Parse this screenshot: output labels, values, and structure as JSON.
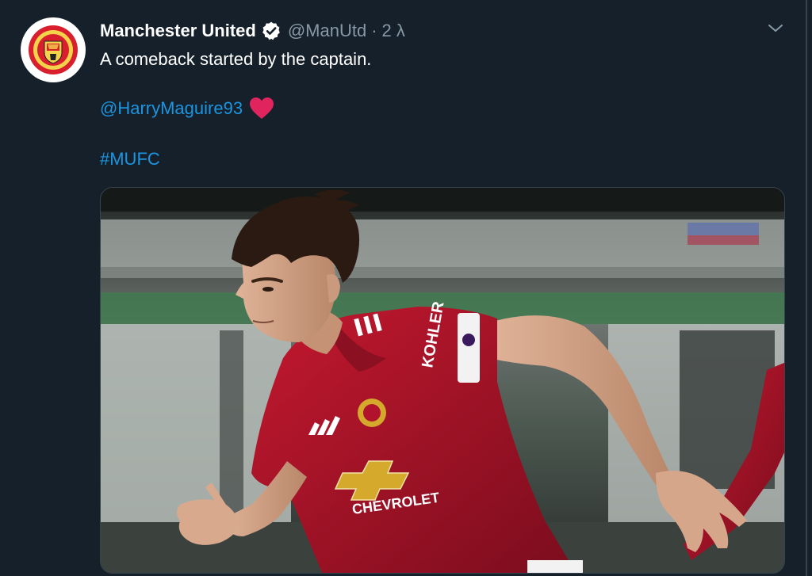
{
  "tweet": {
    "display_name": "Manchester United",
    "handle": "@ManUtd",
    "separator": "·",
    "time": "2 λ",
    "text_line1": "A comeback started by the captain.",
    "mention": "@HarryMaguire93",
    "hashtag": "#MUFC"
  },
  "icons": {
    "avatar": "manchester-united-crest-icon",
    "verified": "verified-badge-icon",
    "caret": "chevron-down-icon",
    "heart": "red-heart-emoji-icon"
  },
  "media": {
    "shirt_sponsor": "CHEVROLET",
    "sleeve_sponsor": "KOHLER"
  },
  "colors": {
    "background": "#15202b",
    "text": "#ffffff",
    "secondary": "#8899a6",
    "link": "#1b95e0",
    "verified": "#ffffff",
    "heart": "#e0245e",
    "kit_red": "#b0132b"
  }
}
